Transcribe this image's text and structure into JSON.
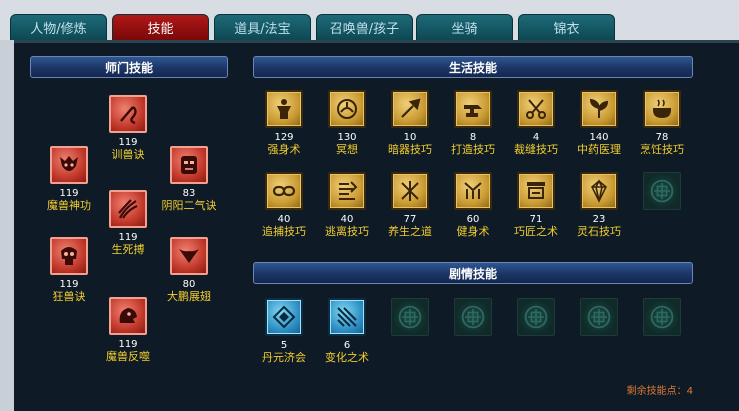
{
  "tabs": [
    {
      "label": "人物/修炼",
      "active": false
    },
    {
      "label": "技能",
      "active": true
    },
    {
      "label": "道具/法宝",
      "active": false
    },
    {
      "label": "召唤兽/孩子",
      "active": false
    },
    {
      "label": "坐骑",
      "active": false
    },
    {
      "label": "锦衣",
      "active": false
    }
  ],
  "sections": {
    "sect": "师门技能",
    "life": "生活技能",
    "plot": "剧情技能"
  },
  "sect_skills": [
    {
      "level": "119",
      "name": "训兽诀",
      "icon": "whip-icon",
      "style": "red"
    },
    {
      "level": "119",
      "name": "魔兽神功",
      "icon": "demon-face-icon",
      "style": "red"
    },
    {
      "level": "83",
      "name": "阴阳二气诀",
      "icon": "mask-icon",
      "style": "red"
    },
    {
      "level": "119",
      "name": "生死搏",
      "icon": "claw-icon",
      "style": "red"
    },
    {
      "level": "119",
      "name": "狂兽诀",
      "icon": "skull-icon",
      "style": "red"
    },
    {
      "level": "80",
      "name": "大鹏展翅",
      "icon": "wings-icon",
      "style": "red"
    },
    {
      "level": "119",
      "name": "魔兽反噬",
      "icon": "beast-head-icon",
      "style": "red"
    }
  ],
  "life_skills": [
    {
      "level": "129",
      "name": "强身术",
      "icon": "body-icon",
      "style": "gold"
    },
    {
      "level": "130",
      "name": "冥想",
      "icon": "meditate-icon",
      "style": "gold"
    },
    {
      "level": "10",
      "name": "暗器技巧",
      "icon": "dart-icon",
      "style": "gold"
    },
    {
      "level": "8",
      "name": "打造技巧",
      "icon": "anvil-icon",
      "style": "gold"
    },
    {
      "level": "4",
      "name": "裁缝技巧",
      "icon": "scissors-icon",
      "style": "gold"
    },
    {
      "level": "140",
      "name": "中药医理",
      "icon": "herb-icon",
      "style": "gold"
    },
    {
      "level": "78",
      "name": "烹饪技巧",
      "icon": "pot-icon",
      "style": "gold"
    },
    {
      "level": "40",
      "name": "追捕技巧",
      "icon": "chain-icon",
      "style": "gold"
    },
    {
      "level": "40",
      "name": "逃离技巧",
      "icon": "run-icon",
      "style": "gold"
    },
    {
      "level": "77",
      "name": "养生之道",
      "icon": "nurture-icon",
      "style": "gold"
    },
    {
      "level": "60",
      "name": "健身术",
      "icon": "fitness-icon",
      "style": "gold"
    },
    {
      "level": "71",
      "name": "巧匠之术",
      "icon": "craft-icon",
      "style": "gold"
    },
    {
      "level": "23",
      "name": "灵石技巧",
      "icon": "gem-icon",
      "style": "gold"
    },
    {
      "level": "",
      "name": "",
      "icon": "empty-slot-icon",
      "style": "empty"
    }
  ],
  "plot_skills": [
    {
      "level": "5",
      "name": "丹元济会",
      "icon": "elixir-icon",
      "style": "blue"
    },
    {
      "level": "6",
      "name": "变化之术",
      "icon": "transform-icon",
      "style": "blue"
    },
    {
      "level": "",
      "name": "",
      "icon": "empty-slot-icon",
      "style": "empty"
    },
    {
      "level": "",
      "name": "",
      "icon": "empty-slot-icon",
      "style": "empty"
    },
    {
      "level": "",
      "name": "",
      "icon": "empty-slot-icon",
      "style": "empty"
    },
    {
      "level": "",
      "name": "",
      "icon": "empty-slot-icon",
      "style": "empty"
    },
    {
      "level": "",
      "name": "",
      "icon": "empty-slot-icon",
      "style": "empty"
    }
  ],
  "remaining_points": "剩余技能点：4"
}
